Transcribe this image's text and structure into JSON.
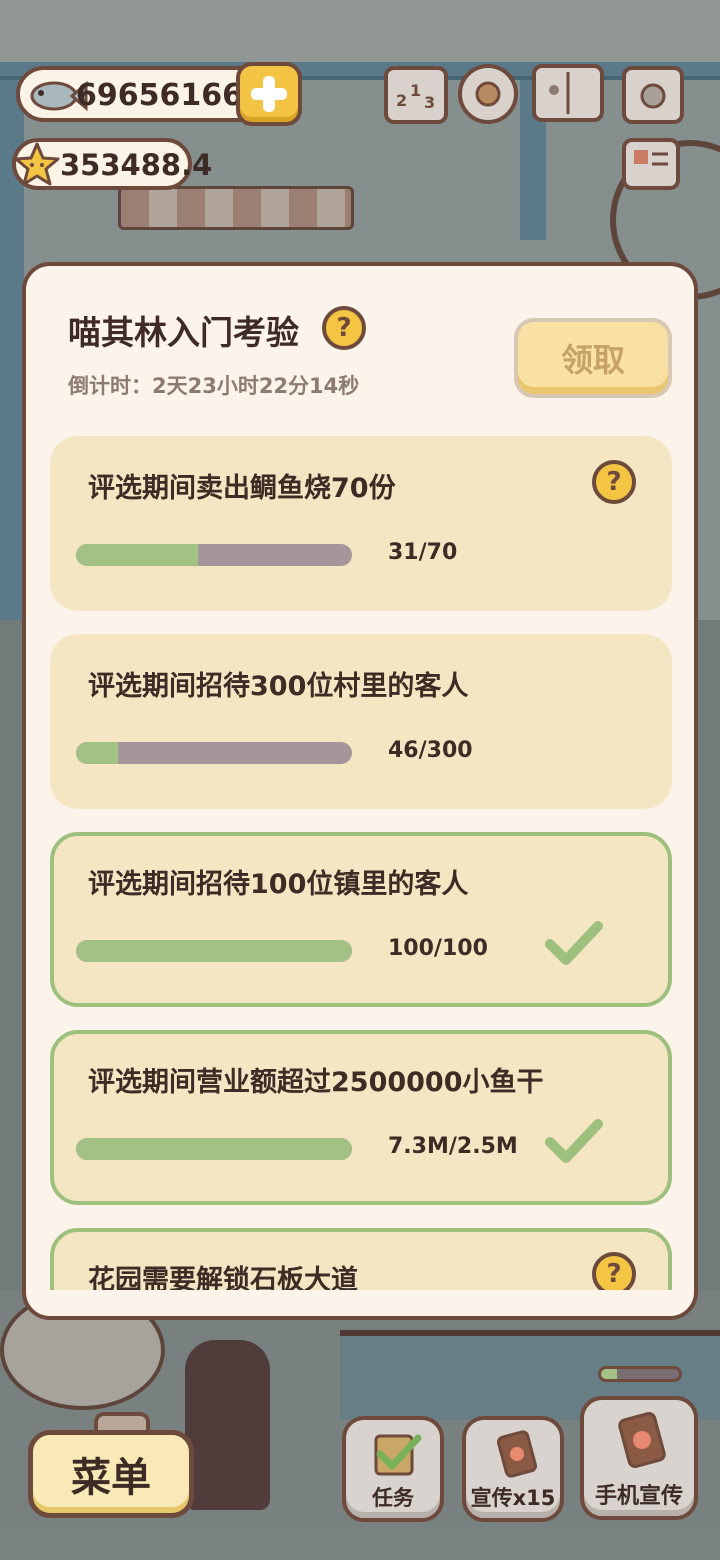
{
  "hud": {
    "fish_amount": "696561660",
    "star_amount": "353488.4"
  },
  "panel": {
    "title": "喵其林入门考验",
    "countdown": "倒计时：2天23小时22分14秒",
    "claim_label": "领取",
    "help_symbol": "?"
  },
  "tasks": [
    {
      "text": "评选期间卖出鲷鱼烧70份",
      "progress": "31/70",
      "fraction": 0.443,
      "done": false
    },
    {
      "text": "评选期间招待300位村里的客人",
      "progress": "46/300",
      "fraction": 0.153,
      "done": false
    },
    {
      "text": "评选期间招待100位镇里的客人",
      "progress": "100/100",
      "fraction": 1.0,
      "done": true
    },
    {
      "text": "评选期间营业额超过2500000小鱼干",
      "progress": "7.3M/2.5M",
      "fraction": 1.0,
      "done": true
    },
    {
      "text": "花园需要解锁石板大道",
      "progress": "",
      "fraction": 0,
      "done": false
    }
  ],
  "bottom": {
    "menu_label": "菜单",
    "task_label": "任务",
    "promo_label": "宣传x15",
    "phone_promo_label": "手机宣传"
  },
  "colors": {
    "accent_yellow": "#f4c443",
    "border_brown": "#6e4a3c",
    "progress_green": "#a4c185",
    "card_bg": "#f4e6c3"
  }
}
